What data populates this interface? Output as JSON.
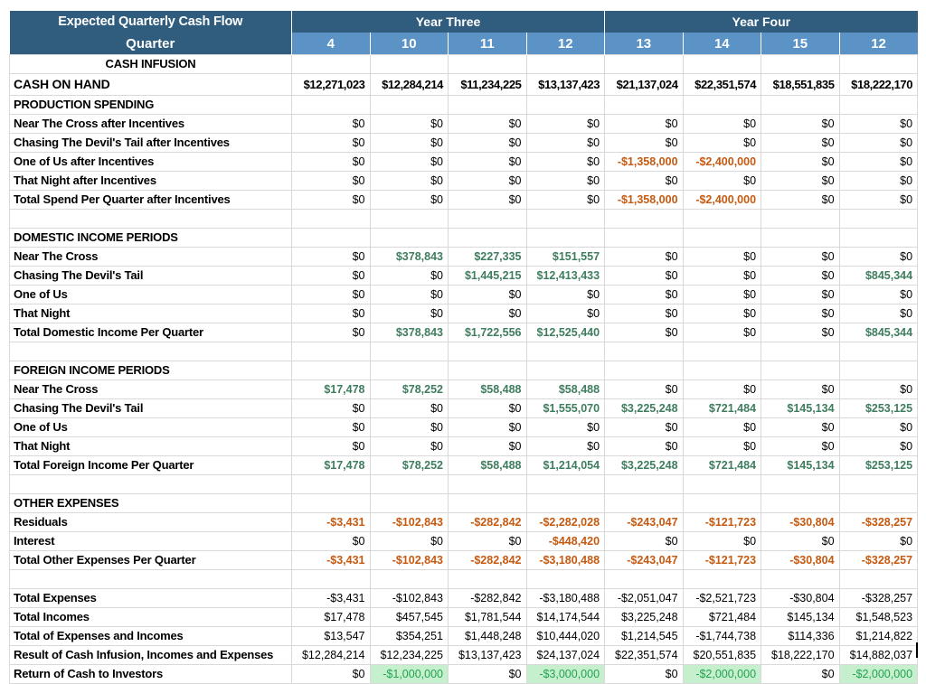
{
  "header": {
    "title": "Expected Quarterly Cash Flow",
    "quarter_label": "Quarter",
    "year_groups": [
      {
        "label": "Year Three",
        "span": 4
      },
      {
        "label": "Year Four",
        "span": 4
      }
    ],
    "quarters": [
      "4",
      "10",
      "11",
      "12",
      "13",
      "14",
      "15",
      "12"
    ]
  },
  "colors": {
    "header_dark_blue": "#305D7E",
    "header_light_blue": "#5B93C6",
    "income_green_text": "#3E7D5E",
    "expense_orange_text": "#C55A11",
    "highlight_green_bg": "#C6EFCE",
    "highlight_green_text": "#21A350",
    "gridline": "#D9D9D9"
  },
  "table": {
    "rows": [
      {
        "type": "section-center",
        "label": "CASH INFUSION"
      },
      {
        "type": "cash",
        "label": "CASH ON HAND",
        "values": [
          "$12,271,023",
          "$12,284,214",
          "$11,234,225",
          "$13,137,423",
          "$21,137,024",
          "$22,351,574",
          "$18,551,835",
          "$18,222,170"
        ],
        "styles": [
          "k",
          "k",
          "k",
          "k",
          "k",
          "k",
          "k",
          "k"
        ]
      },
      {
        "type": "section",
        "label": "PRODUCTION SPENDING"
      },
      {
        "type": "data",
        "label": "Near The Cross after Incentives",
        "values": [
          "$0",
          "$0",
          "$0",
          "$0",
          "$0",
          "$0",
          "$0",
          "$0"
        ],
        "styles": [
          "k",
          "k",
          "k",
          "k",
          "k",
          "k",
          "k",
          "k"
        ]
      },
      {
        "type": "data",
        "label": "Chasing The Devil's Tail after Incentives",
        "values": [
          "$0",
          "$0",
          "$0",
          "$0",
          "$0",
          "$0",
          "$0",
          "$0"
        ],
        "styles": [
          "k",
          "k",
          "k",
          "k",
          "k",
          "k",
          "k",
          "k"
        ]
      },
      {
        "type": "data",
        "label": "One of Us after Incentives",
        "values": [
          "$0",
          "$0",
          "$0",
          "$0",
          "-$1,358,000",
          "-$2,400,000",
          "$0",
          "$0"
        ],
        "styles": [
          "k",
          "k",
          "k",
          "k",
          "o",
          "o",
          "k",
          "k"
        ]
      },
      {
        "type": "data",
        "label": "That Night after Incentives",
        "values": [
          "$0",
          "$0",
          "$0",
          "$0",
          "$0",
          "$0",
          "$0",
          "$0"
        ],
        "styles": [
          "k",
          "k",
          "k",
          "k",
          "k",
          "k",
          "k",
          "k"
        ]
      },
      {
        "type": "data",
        "label": "Total Spend Per Quarter after Incentives",
        "values": [
          "$0",
          "$0",
          "$0",
          "$0",
          "-$1,358,000",
          "-$2,400,000",
          "$0",
          "$0"
        ],
        "styles": [
          "k",
          "k",
          "k",
          "k",
          "o",
          "o",
          "k",
          "k"
        ]
      },
      {
        "type": "blank"
      },
      {
        "type": "section",
        "label": "DOMESTIC INCOME PERIODS"
      },
      {
        "type": "data",
        "label": "Near The Cross",
        "values": [
          "$0",
          "$378,843",
          "$227,335",
          "$151,557",
          "$0",
          "$0",
          "$0",
          "$0"
        ],
        "styles": [
          "k",
          "g",
          "g",
          "g",
          "k",
          "k",
          "k",
          "k"
        ]
      },
      {
        "type": "data",
        "label": "Chasing The Devil's Tail",
        "values": [
          "$0",
          "$0",
          "$1,445,215",
          "$12,413,433",
          "$0",
          "$0",
          "$0",
          "$845,344"
        ],
        "styles": [
          "k",
          "k",
          "g",
          "g",
          "k",
          "k",
          "k",
          "g"
        ]
      },
      {
        "type": "data",
        "label": "One of Us",
        "values": [
          "$0",
          "$0",
          "$0",
          "$0",
          "$0",
          "$0",
          "$0",
          "$0"
        ],
        "styles": [
          "k",
          "k",
          "k",
          "k",
          "k",
          "k",
          "k",
          "k"
        ]
      },
      {
        "type": "data",
        "label": "That Night",
        "values": [
          "$0",
          "$0",
          "$0",
          "$0",
          "$0",
          "$0",
          "$0",
          "$0"
        ],
        "styles": [
          "k",
          "k",
          "k",
          "k",
          "k",
          "k",
          "k",
          "k"
        ]
      },
      {
        "type": "data",
        "label": "Total Domestic Income Per Quarter",
        "values": [
          "$0",
          "$378,843",
          "$1,722,556",
          "$12,525,440",
          "$0",
          "$0",
          "$0",
          "$845,344"
        ],
        "styles": [
          "k",
          "g",
          "g",
          "g",
          "k",
          "k",
          "k",
          "g"
        ]
      },
      {
        "type": "blank"
      },
      {
        "type": "section",
        "label": "FOREIGN INCOME PERIODS"
      },
      {
        "type": "data",
        "label": "Near The Cross",
        "values": [
          "$17,478",
          "$78,252",
          "$58,488",
          "$58,488",
          "$0",
          "$0",
          "$0",
          "$0"
        ],
        "styles": [
          "g",
          "g",
          "g",
          "g",
          "k",
          "k",
          "k",
          "k"
        ]
      },
      {
        "type": "data",
        "label": "Chasing The Devil's Tail",
        "values": [
          "$0",
          "$0",
          "$0",
          "$1,555,070",
          "$3,225,248",
          "$721,484",
          "$145,134",
          "$253,125"
        ],
        "styles": [
          "k",
          "k",
          "k",
          "g",
          "g",
          "g",
          "g",
          "g"
        ]
      },
      {
        "type": "data",
        "label": "One of Us",
        "values": [
          "$0",
          "$0",
          "$0",
          "$0",
          "$0",
          "$0",
          "$0",
          "$0"
        ],
        "styles": [
          "k",
          "k",
          "k",
          "k",
          "k",
          "k",
          "k",
          "k"
        ]
      },
      {
        "type": "data",
        "label": "That Night",
        "values": [
          "$0",
          "$0",
          "$0",
          "$0",
          "$0",
          "$0",
          "$0",
          "$0"
        ],
        "styles": [
          "k",
          "k",
          "k",
          "k",
          "k",
          "k",
          "k",
          "k"
        ]
      },
      {
        "type": "data",
        "label": "Total Foreign Income Per Quarter",
        "values": [
          "$17,478",
          "$78,252",
          "$58,488",
          "$1,214,054",
          "$3,225,248",
          "$721,484",
          "$145,134",
          "$253,125"
        ],
        "styles": [
          "g",
          "g",
          "g",
          "g",
          "g",
          "g",
          "g",
          "g"
        ]
      },
      {
        "type": "blank"
      },
      {
        "type": "section",
        "label": "OTHER EXPENSES"
      },
      {
        "type": "data",
        "label": "Residuals",
        "values": [
          "-$3,431",
          "-$102,843",
          "-$282,842",
          "-$2,282,028",
          "-$243,047",
          "-$121,723",
          "-$30,804",
          "-$328,257"
        ],
        "styles": [
          "o",
          "o",
          "o",
          "o",
          "o",
          "o",
          "o",
          "o"
        ]
      },
      {
        "type": "data",
        "label": "Interest",
        "values": [
          "$0",
          "$0",
          "$0",
          "-$448,420",
          "$0",
          "$0",
          "$0",
          "$0"
        ],
        "styles": [
          "k",
          "k",
          "k",
          "o",
          "k",
          "k",
          "k",
          "k"
        ]
      },
      {
        "type": "data",
        "label": "Total Other Expenses Per Quarter",
        "values": [
          "-$3,431",
          "-$102,843",
          "-$282,842",
          "-$3,180,488",
          "-$243,047",
          "-$121,723",
          "-$30,804",
          "-$328,257"
        ],
        "styles": [
          "o",
          "o",
          "o",
          "o",
          "o",
          "o",
          "o",
          "o"
        ]
      },
      {
        "type": "blank"
      },
      {
        "type": "data",
        "label": "Total Expenses",
        "values": [
          "-$3,431",
          "-$102,843",
          "-$282,842",
          "-$3,180,488",
          "-$2,051,047",
          "-$2,521,723",
          "-$30,804",
          "-$328,257"
        ],
        "styles": [
          "k",
          "k",
          "k",
          "k",
          "k",
          "k",
          "k",
          "k"
        ]
      },
      {
        "type": "data",
        "label": "Total Incomes",
        "values": [
          "$17,478",
          "$457,545",
          "$1,781,544",
          "$14,174,544",
          "$3,225,248",
          "$721,484",
          "$145,134",
          "$1,548,523"
        ],
        "styles": [
          "k",
          "k",
          "k",
          "k",
          "k",
          "k",
          "k",
          "k"
        ]
      },
      {
        "type": "data",
        "label": "Total of Expenses and Incomes",
        "values": [
          "$13,547",
          "$354,251",
          "$1,448,248",
          "$10,444,020",
          "$1,214,545",
          "-$1,744,738",
          "$114,336",
          "$1,214,822"
        ],
        "styles": [
          "k",
          "k",
          "k",
          "k",
          "k",
          "k",
          "k",
          "k"
        ]
      },
      {
        "type": "data",
        "label": "Result of Cash Infusion, Incomes and Expenses",
        "values": [
          "$12,284,214",
          "$12,234,225",
          "$13,137,423",
          "$24,137,024",
          "$22,351,574",
          "$20,551,835",
          "$18,222,170",
          "$14,882,037"
        ],
        "styles": [
          "k",
          "k",
          "k",
          "k",
          "k",
          "k",
          "k",
          "k"
        ]
      },
      {
        "type": "data",
        "label": "Return of Cash to Investors",
        "values": [
          "$0",
          "-$1,000,000",
          "$0",
          "-$3,000,000",
          "$0",
          "-$2,000,000",
          "$0",
          "-$2,000,000"
        ],
        "styles": [
          "k",
          "h",
          "k",
          "h",
          "k",
          "h",
          "k",
          "h"
        ]
      }
    ]
  }
}
